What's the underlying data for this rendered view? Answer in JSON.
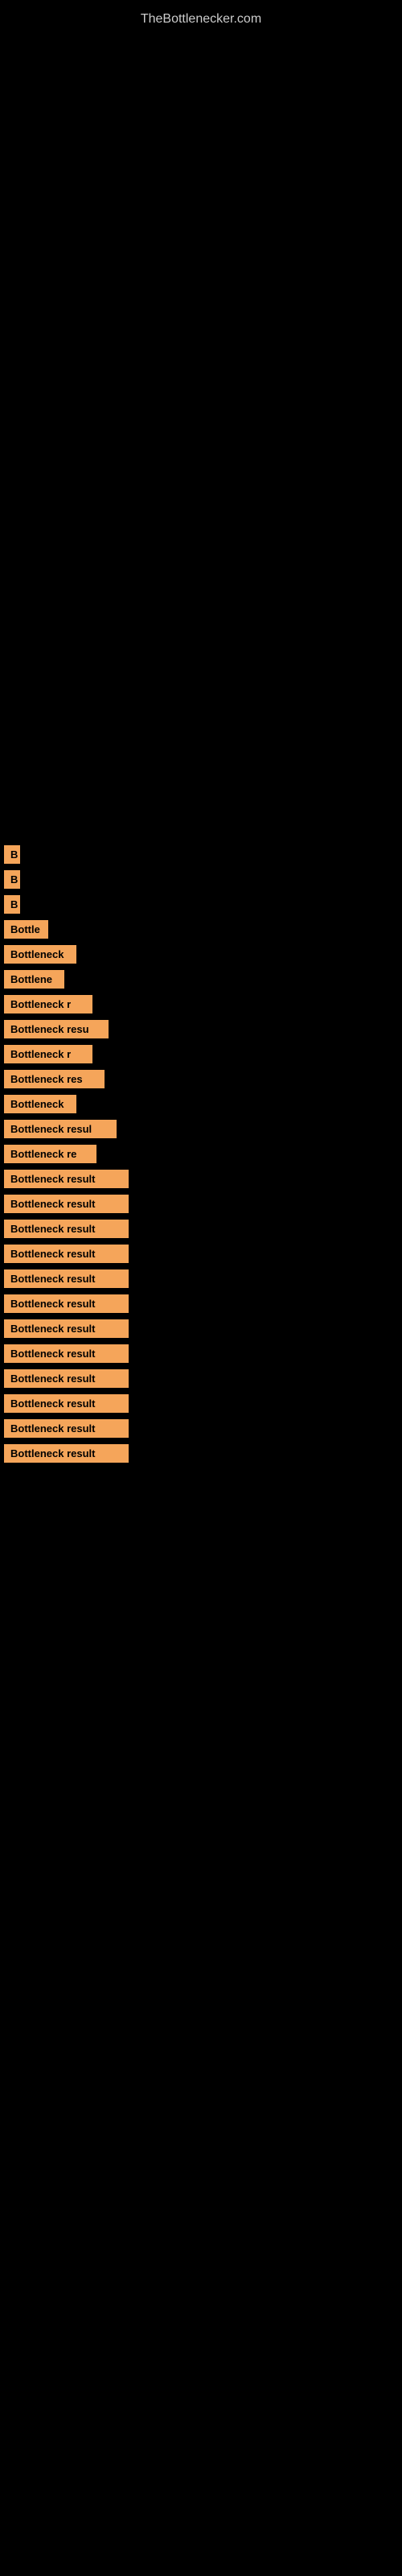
{
  "site": {
    "title": "TheBottlenecker.com"
  },
  "items": [
    {
      "label": "B",
      "width": 20
    },
    {
      "label": "B",
      "width": 20
    },
    {
      "label": "B",
      "width": 20
    },
    {
      "label": "Bottle",
      "width": 55
    },
    {
      "label": "Bottleneck",
      "width": 90
    },
    {
      "label": "Bottlene",
      "width": 75
    },
    {
      "label": "Bottleneck r",
      "width": 110
    },
    {
      "label": "Bottleneck resu",
      "width": 130
    },
    {
      "label": "Bottleneck r",
      "width": 110
    },
    {
      "label": "Bottleneck res",
      "width": 125
    },
    {
      "label": "Bottleneck",
      "width": 90
    },
    {
      "label": "Bottleneck resul",
      "width": 140
    },
    {
      "label": "Bottleneck re",
      "width": 115
    },
    {
      "label": "Bottleneck result",
      "width": 155
    },
    {
      "label": "Bottleneck result",
      "width": 155
    },
    {
      "label": "Bottleneck result",
      "width": 155
    },
    {
      "label": "Bottleneck result",
      "width": 155
    },
    {
      "label": "Bottleneck result",
      "width": 155
    },
    {
      "label": "Bottleneck result",
      "width": 155
    },
    {
      "label": "Bottleneck result",
      "width": 155
    },
    {
      "label": "Bottleneck result",
      "width": 155
    },
    {
      "label": "Bottleneck result",
      "width": 155
    },
    {
      "label": "Bottleneck result",
      "width": 155
    },
    {
      "label": "Bottleneck result",
      "width": 155
    },
    {
      "label": "Bottleneck result",
      "width": 155
    }
  ]
}
